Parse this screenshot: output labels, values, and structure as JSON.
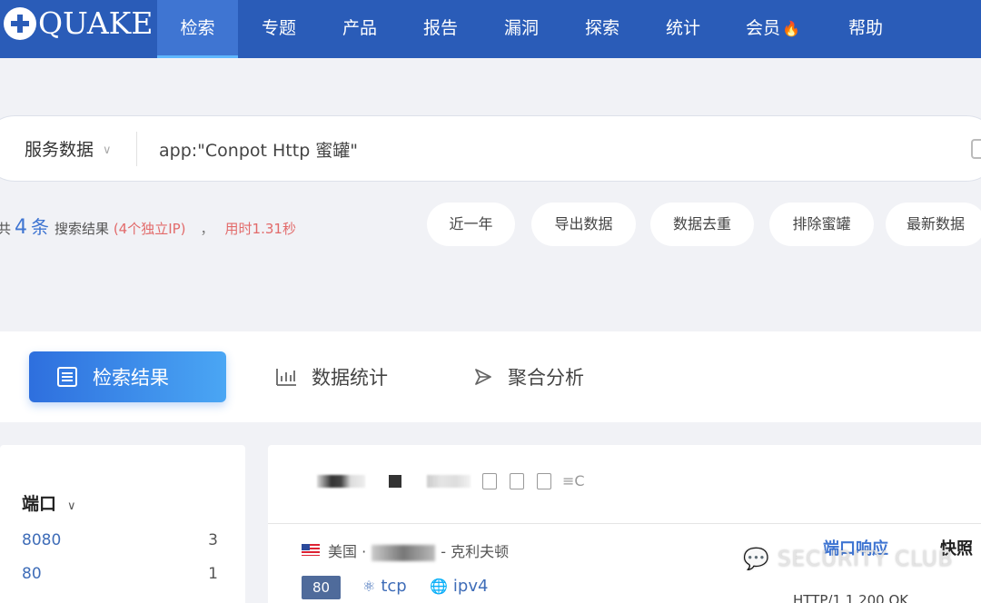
{
  "nav": {
    "logo_text": "QUAKE",
    "items": [
      {
        "label": "检索",
        "active": true
      },
      {
        "label": "专题"
      },
      {
        "label": "产品"
      },
      {
        "label": "报告"
      },
      {
        "label": "漏洞"
      },
      {
        "label": "探索"
      },
      {
        "label": "统计"
      },
      {
        "label": "会员"
      },
      {
        "label": "帮助"
      }
    ]
  },
  "search": {
    "type_label": "服务数据",
    "query": "app:\"Conpot Http 蜜罐\""
  },
  "result": {
    "prefix": "共",
    "count": "4",
    "unit": "条",
    "label": "搜索结果",
    "ip_note": "(4个独立IP)",
    "separator": "，",
    "time": "用时1.31秒"
  },
  "filters": [
    "近一年",
    "导出数据",
    "数据去重",
    "排除蜜罐",
    "最新数据"
  ],
  "tabs": [
    {
      "label": "检索结果",
      "active": true
    },
    {
      "label": "数据统计"
    },
    {
      "label": "聚合分析"
    }
  ],
  "left_panel": {
    "title": "端口",
    "ports": [
      {
        "port": "8080",
        "count": "3"
      },
      {
        "port": "80",
        "count": "1"
      }
    ]
  },
  "result_card": {
    "country": "美国",
    "dot": "·",
    "city": "- 克利夫顿",
    "port": "80",
    "transport": "tcp",
    "ip_version": "ipv4",
    "response_tab": "端口响应",
    "snapshot_tab": "快照",
    "response_preview": "HTTP/1.1 200 OK"
  },
  "watermark": "SECURITY CLUB",
  "colors": {
    "nav_bg": "#2a5cb8",
    "accent": "#3f75d2",
    "highlight_red": "#e26a6a"
  }
}
